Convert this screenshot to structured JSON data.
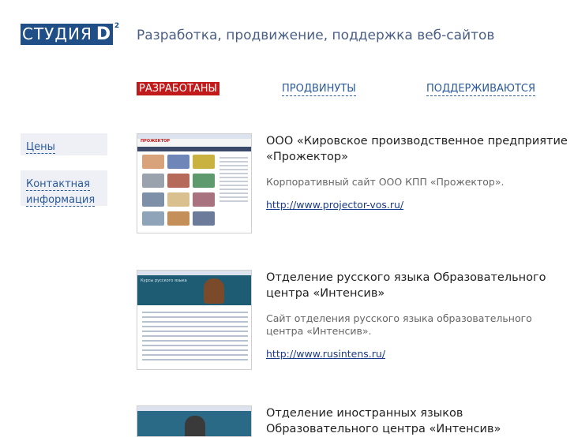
{
  "brand": {
    "logo_text": "СТУДИЯ",
    "logo_letter": "D",
    "logo_sup": "2"
  },
  "tagline": "Разработка, продвижение, поддержка веб-сайтов",
  "tabs": [
    {
      "label": "РАЗРАБОТАНЫ",
      "active": true
    },
    {
      "label": "ПРОДВИНУТЫ",
      "active": false
    },
    {
      "label": "ПОДДЕРЖИВАЮТСЯ",
      "active": false
    }
  ],
  "sidebar": {
    "items": [
      {
        "label": "Цены"
      },
      {
        "label": "Контактная информация"
      }
    ]
  },
  "projects": [
    {
      "title": "ООО «Кировское производственное предприятие «Прожектор»",
      "description": "Корпоративный сайт ООО КПП «Прожектор».",
      "url": "http://www.projector-vos.ru/",
      "thumb_brand": "ПРОЖЕКТОР"
    },
    {
      "title": "Отделение русского языка Образовательного центра «Интенсив»",
      "description": "Сайт отделения русского языка образовательного центра «Интенсив».",
      "url": "http://www.rusintens.ru/",
      "thumb_brand": "Курсы русского языка"
    },
    {
      "title": "Отделение иностранных языков Образовательного центра «Интенсив»",
      "description": "",
      "url": ""
    }
  ],
  "colors": {
    "brand_blue": "#1f4f86",
    "active_tab": "#c21a1a",
    "link": "#2a5a9a",
    "sidebar_bg": "#eef0f5"
  }
}
